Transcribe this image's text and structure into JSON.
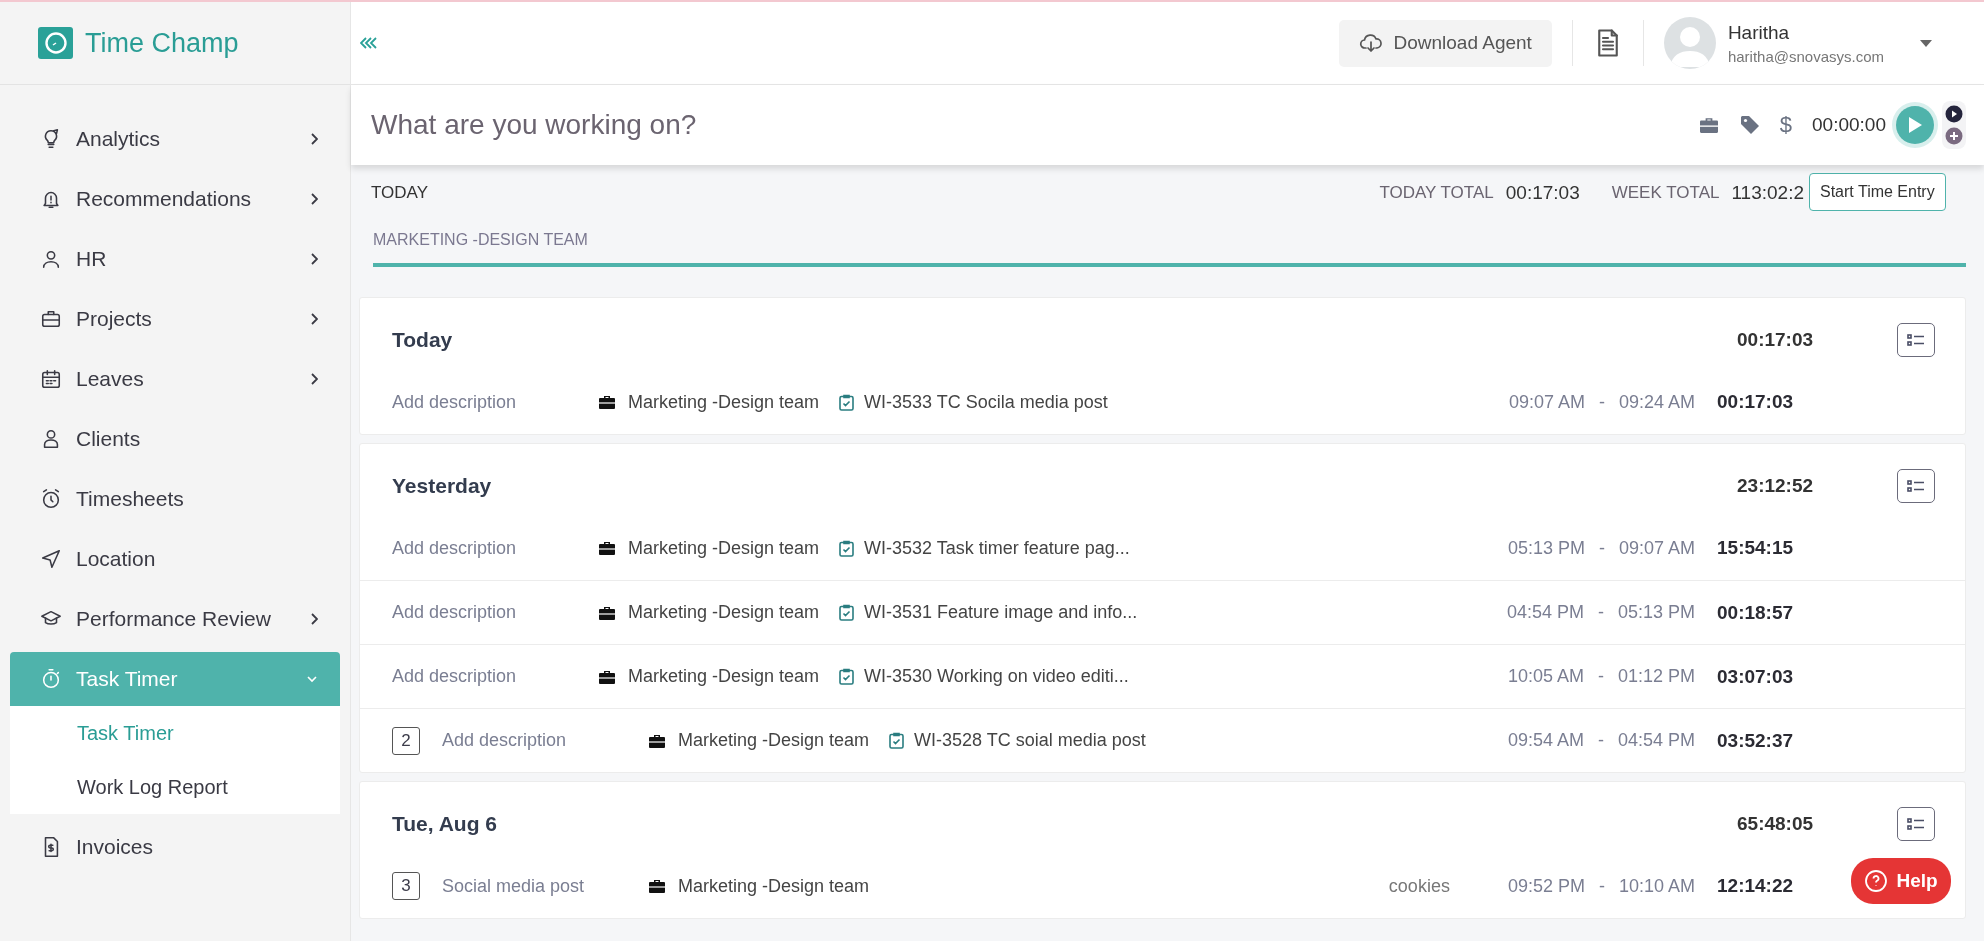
{
  "brand": {
    "name": "Time Champ"
  },
  "sidebar": {
    "items": [
      {
        "label": "Analytics",
        "kind": "group",
        "expanded": false,
        "selected": false
      },
      {
        "label": "Recommendations",
        "kind": "group",
        "expanded": false,
        "selected": false
      },
      {
        "label": "HR",
        "kind": "group",
        "expanded": false,
        "selected": false
      },
      {
        "label": "Projects",
        "kind": "group",
        "expanded": false,
        "selected": false
      },
      {
        "label": "Leaves",
        "kind": "group",
        "expanded": false,
        "selected": false
      },
      {
        "label": "Clients",
        "kind": "link",
        "selected": false
      },
      {
        "label": "Timesheets",
        "kind": "link",
        "selected": false
      },
      {
        "label": "Location",
        "kind": "link",
        "selected": false
      },
      {
        "label": "Performance Review",
        "kind": "group",
        "expanded": false,
        "selected": false
      },
      {
        "label": "Task Timer",
        "kind": "group",
        "expanded": true,
        "selected": true,
        "children": [
          {
            "label": "Task Timer",
            "selected": true
          },
          {
            "label": "Work Log Report",
            "selected": false
          }
        ]
      },
      {
        "label": "Invoices",
        "kind": "link",
        "selected": false
      }
    ]
  },
  "header": {
    "download_button": "Download Agent",
    "user": {
      "name": "Haritha",
      "email": "haritha@snovasys.com"
    }
  },
  "timer_bar": {
    "placeholder": "What are you working on?",
    "billable_symbol": "$",
    "elapsed": "00:00:00",
    "tooltip": "Start Time Entry"
  },
  "totals": {
    "period": "TODAY",
    "today_label": "TODAY TOTAL",
    "today_value": "00:17:03",
    "week_label": "WEEK TOTAL",
    "week_value": "113:02:2"
  },
  "tabs": [
    {
      "label": "MARKETING -DESIGN TEAM",
      "selected": true
    }
  ],
  "groups": [
    {
      "title": "Today",
      "total": "00:17:03",
      "entries": [
        {
          "description": "Add description",
          "project": "Marketing -Design team",
          "task": "WI-3533 TC Socila media post",
          "start": "09:07 AM",
          "separator": "-",
          "end": "09:24 AM",
          "duration": "00:17:03"
        }
      ]
    },
    {
      "title": "Yesterday",
      "total": "23:12:52",
      "entries": [
        {
          "description": "Add description",
          "project": "Marketing -Design team",
          "task": "WI-3532 Task timer feature pag...",
          "start": "05:13 PM",
          "separator": "-",
          "end": "09:07 AM",
          "duration": "15:54:15"
        },
        {
          "description": "Add description",
          "project": "Marketing -Design team",
          "task": "WI-3531 Feature image and info...",
          "start": "04:54 PM",
          "separator": "-",
          "end": "05:13 PM",
          "duration": "00:18:57"
        },
        {
          "description": "Add description",
          "project": "Marketing -Design team",
          "task": "WI-3530 Working on video editi...",
          "start": "10:05 AM",
          "separator": "-",
          "end": "01:12 PM",
          "duration": "03:07:03"
        },
        {
          "count": "2",
          "description": "Add description",
          "project": "Marketing -Design team",
          "task": "WI-3528 TC soial media post",
          "start": "09:54 AM",
          "separator": "-",
          "end": "04:54 PM",
          "duration": "03:52:37"
        }
      ]
    },
    {
      "title": "Tue, Aug 6",
      "total": "65:48:05",
      "entries": [
        {
          "count": "3",
          "description": "Social media post",
          "project": "Marketing -Design team",
          "tag": "cookies",
          "start": "09:52 PM",
          "separator": "-",
          "end": "10:10 AM",
          "duration": "12:14:22"
        }
      ]
    }
  ],
  "help_button": "Help"
}
